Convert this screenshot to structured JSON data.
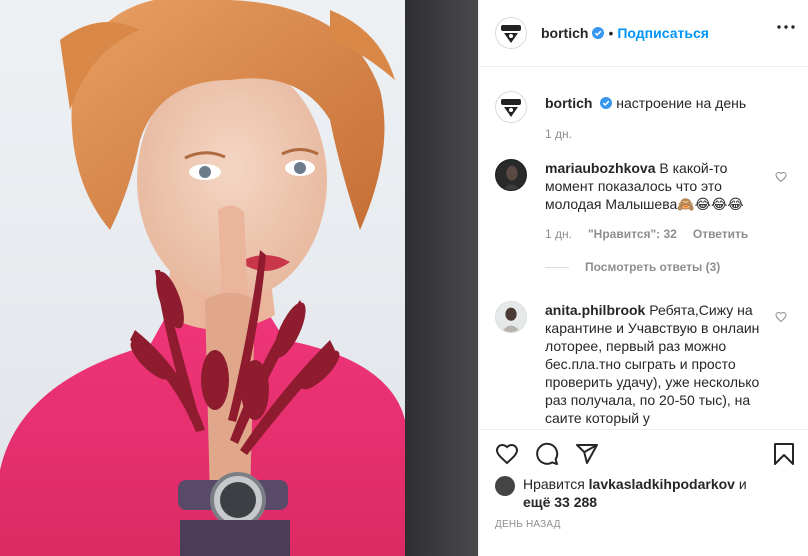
{
  "post": {
    "author": "bortich",
    "follow_label": "Подписаться",
    "dot": "•",
    "image_alt": "Portrait photo: young woman with red hair in a pink sweater holding dark red flowers"
  },
  "caption": {
    "username": "bortich",
    "text": "настроение на день",
    "time": "1 дн."
  },
  "comments": [
    {
      "username": "mariaubozhkova",
      "text": "В какой-то момент показалось что это молодая Малышева🙈😂😂😂",
      "time": "1 дн.",
      "likes": "\"Нравится\": 32",
      "reply": "Ответить",
      "view_replies": "Посмотреть ответы (3)"
    },
    {
      "username": "anita.philbrook",
      "text": "Ребята,Сижу на карантине и Учавствую в онлаин лоторее, первый раз можно бес.пла.тно сыграть и просто проверить удачу), уже несколько раз получала, по 20-50 тыс), на саите который у"
    }
  ],
  "likes": {
    "prefix": "Нравится ",
    "user": "lavkasladkihpodarkov",
    "and": " и",
    "more": "ещё 33 288"
  },
  "timestamp": "ДЕНЬ НАЗАД",
  "colors": {
    "link_blue": "#0095f6",
    "verified_blue": "#3897f0",
    "muted": "#8e8e8e",
    "sweater_pink": "#e8316f",
    "flowers_red": "#8e1c2e",
    "hair_orange": "#d98848"
  },
  "icons": [
    "verified-icon",
    "more-options-icon",
    "heart-icon",
    "comment-icon",
    "share-icon",
    "bookmark-icon"
  ]
}
